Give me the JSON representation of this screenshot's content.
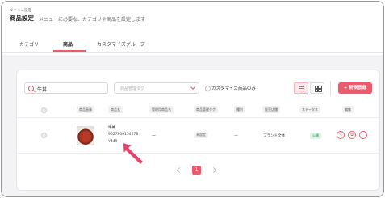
{
  "header": {
    "breadcrumb": "メニュー設定",
    "title": "商品設定",
    "subtitle": "メニューに必要な、カテゴリや商品を設定します"
  },
  "tabs": [
    {
      "label": "カテゴリ",
      "active": false
    },
    {
      "label": "商品",
      "active": true
    },
    {
      "label": "カスタマイズグループ",
      "active": false
    }
  ],
  "toolbar": {
    "search_value": "牛丼",
    "tag_placeholder": "商品管理タグ",
    "custom_only_label": "カスタマイズ商品のみ",
    "new_button_label": "+ 新規登録",
    "list_view_icon": "list-icon",
    "grid_view_icon": "grid-icon"
  },
  "table": {
    "headers": [
      "商品画像",
      "商品名",
      "管理用商品名",
      "商品管理タグ",
      "種別",
      "販売店舗",
      "ステータス",
      "編集"
    ],
    "rows": [
      {
        "name": "牛丼",
        "code": "9027809154278",
        "price": "¥449",
        "admin_name": "ー",
        "tag": "未設定",
        "type": "ー",
        "stores": "ブランド全体",
        "status": "公開"
      }
    ]
  },
  "pagination": {
    "current": "1"
  },
  "colors": {
    "accent": "#ef5a6b",
    "status_green": "#2e8b57"
  }
}
